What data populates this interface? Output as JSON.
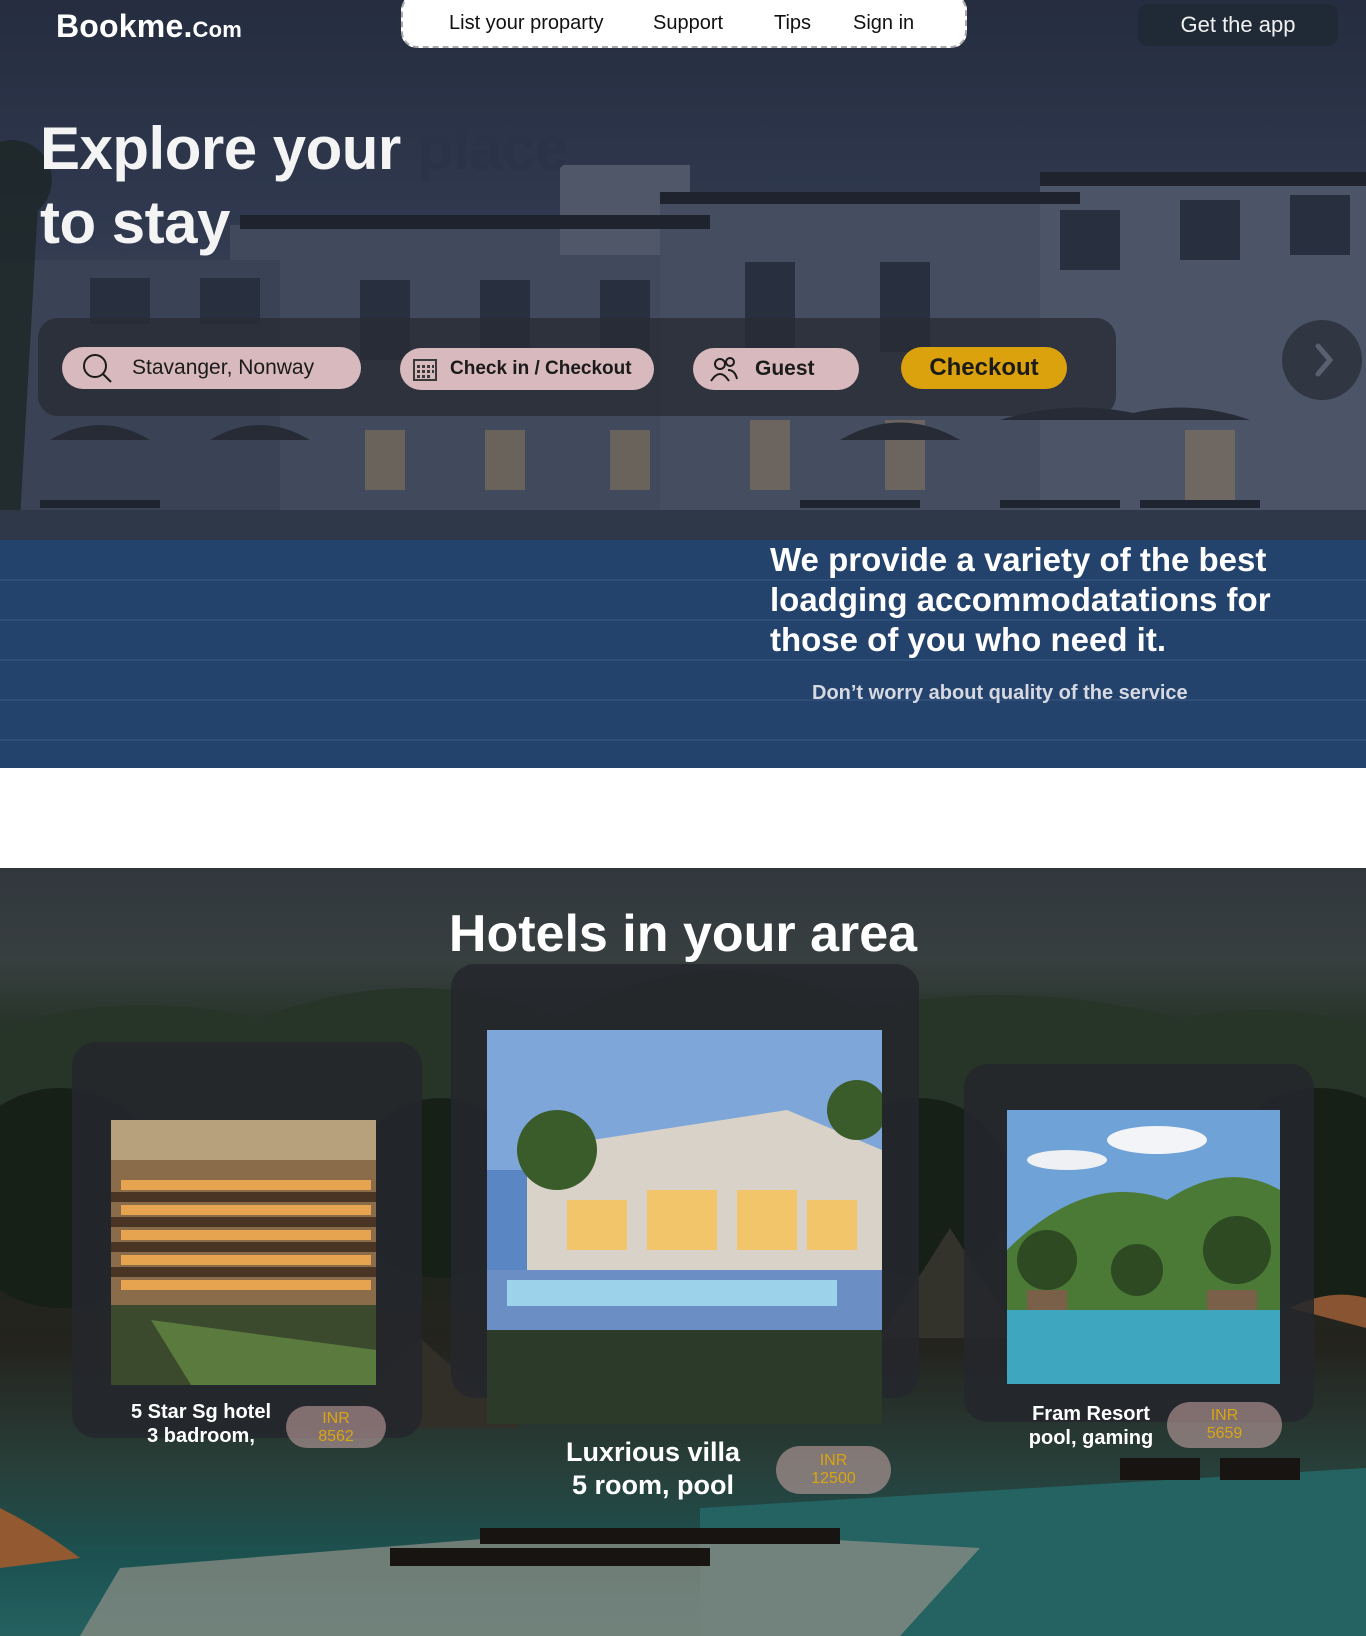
{
  "header": {
    "logo_main": "Bookme.",
    "logo_suffix": "Com",
    "nav": [
      "List your proparty",
      "Support",
      "Tips",
      "Sign in"
    ],
    "get_app": "Get the app"
  },
  "hero": {
    "headline_part1": "Explore your",
    "headline_part2": "place",
    "headline_part3": "to stay",
    "tagline": "We provide a variety of the best loadging accommodatations for those of you who need it.",
    "subtagline": "Don’t worry about quality of the service"
  },
  "search": {
    "location": "Stavanger, Nonway",
    "dates": "Check in / Checkout",
    "guests": "Guest",
    "submit": "Checkout"
  },
  "hotels": {
    "title": "Hotels in your area",
    "items": [
      {
        "line1": "5 Star Sg hotel",
        "line2": "3 badroom,",
        "currency": "INR",
        "price": "8562"
      },
      {
        "line1": "Luxrious villa",
        "line2": "5 room, pool",
        "currency": "INR",
        "price": "12500"
      },
      {
        "line1": "Fram Resort",
        "line2": "pool, gaming",
        "currency": "INR",
        "price": "5659"
      }
    ]
  },
  "colors": {
    "accent": "#dba20d",
    "pill": "#d8b9bd",
    "nav_dark": "#1f2a36"
  }
}
